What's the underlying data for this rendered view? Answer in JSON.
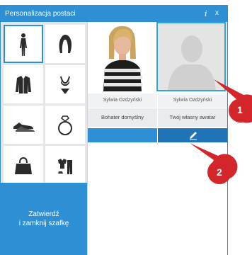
{
  "window": {
    "title": "Personalizacja postaci",
    "info_icon": "i",
    "close_icon": "x"
  },
  "categories": [
    {
      "name": "body",
      "icon": "person-icon"
    },
    {
      "name": "hair",
      "icon": "hair-icon"
    },
    {
      "name": "jacket",
      "icon": "jacket-icon"
    },
    {
      "name": "underwear",
      "icon": "bikini-icon"
    },
    {
      "name": "shoes",
      "icon": "shoe-icon"
    },
    {
      "name": "ring",
      "icon": "ring-icon"
    },
    {
      "name": "bag",
      "icon": "handbag-icon"
    },
    {
      "name": "outfit",
      "icon": "outfit-icon"
    }
  ],
  "confirm": {
    "line1": "Zatwierdź",
    "line2": "i zamknij szafkę"
  },
  "avatars": [
    {
      "name": "Sylwia Ozdzyński",
      "desc": "Bohater domyślny"
    },
    {
      "name": "Sylwia Ozdzyński",
      "desc": "Twój własny awatar"
    }
  ],
  "callouts": [
    "1",
    "2"
  ],
  "colors": {
    "accent": "#2e8fd4",
    "callout": "#d3262b"
  }
}
